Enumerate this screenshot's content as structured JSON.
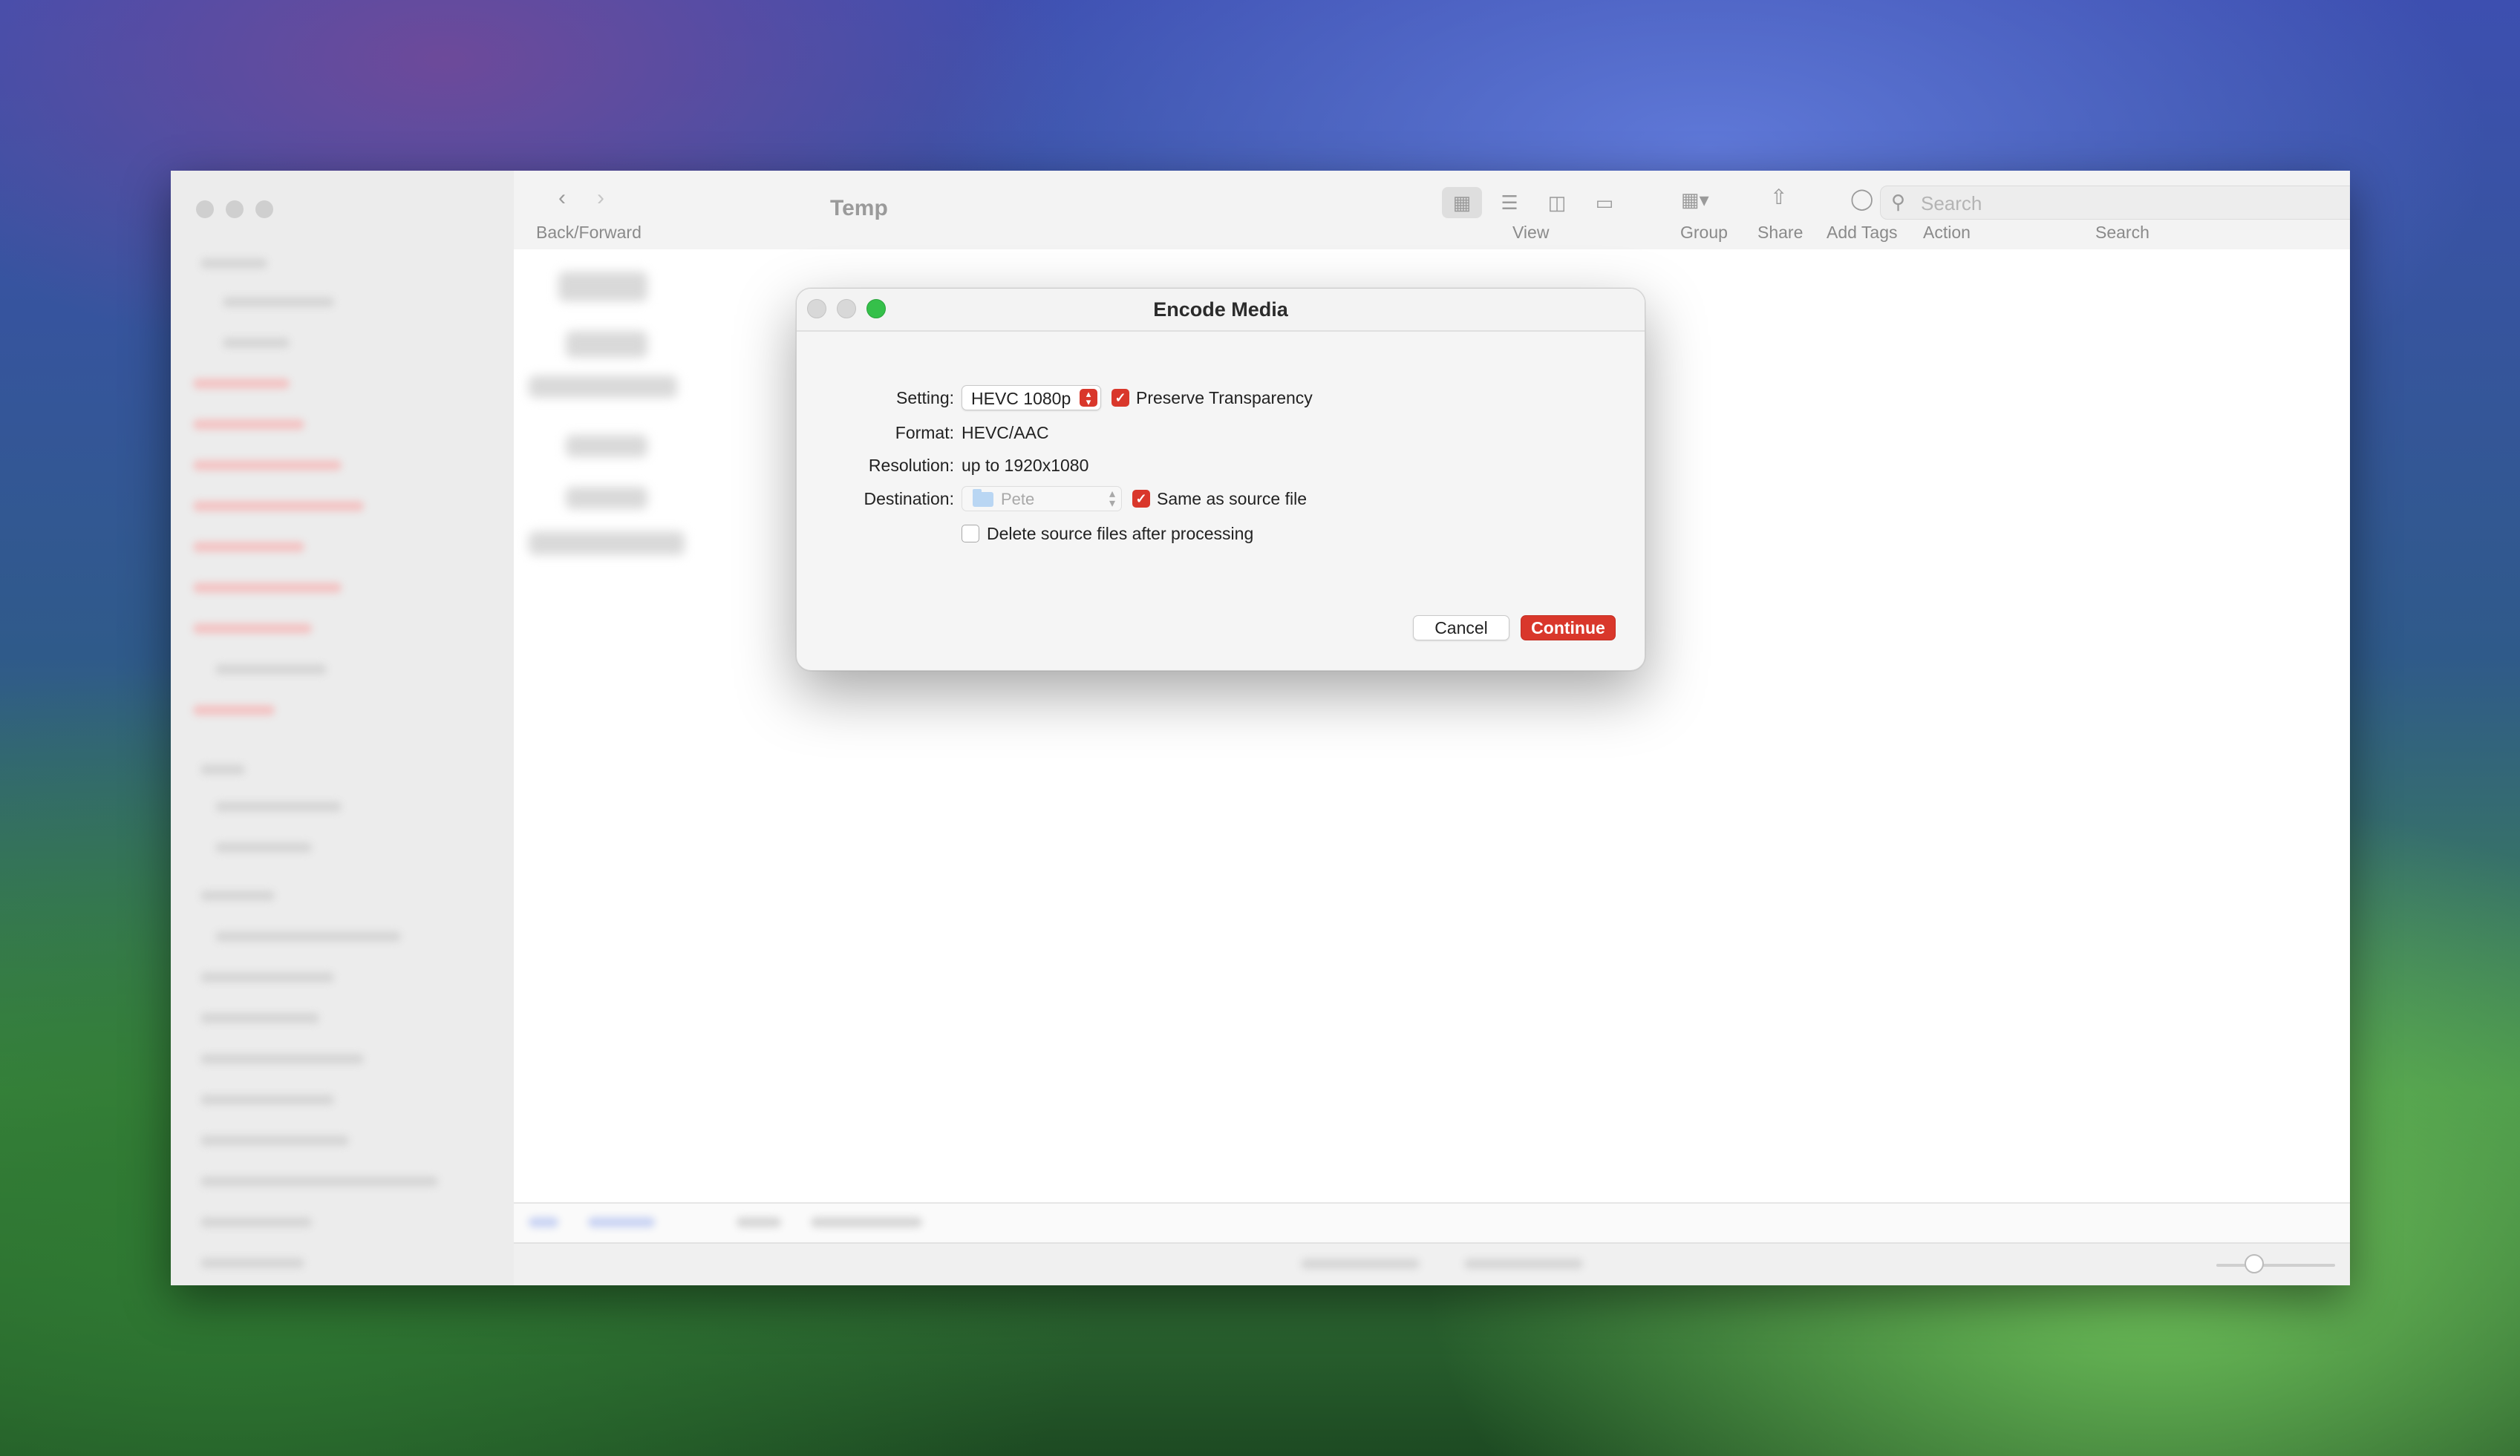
{
  "finder": {
    "title": "Temp",
    "toolbar": {
      "back_forward_label": "Back/Forward",
      "view_label": "View",
      "group_label": "Group",
      "share_label": "Share",
      "add_tags_label": "Add Tags",
      "action_label": "Action",
      "search_label": "Search",
      "search_placeholder": "Search"
    }
  },
  "dialog": {
    "title": "Encode Media",
    "setting_label": "Setting:",
    "setting_value": "HEVC 1080p",
    "preserve_transparency_label": "Preserve Transparency",
    "preserve_transparency_checked": true,
    "format_label": "Format:",
    "format_value": "HEVC/AAC",
    "resolution_label": "Resolution:",
    "resolution_value": "up to 1920x1080",
    "destination_label": "Destination:",
    "destination_value": "Pete",
    "same_as_source_label": "Same as source file",
    "same_as_source_checked": true,
    "delete_source_label": "Delete source files after processing",
    "delete_source_checked": false,
    "cancel_label": "Cancel",
    "continue_label": "Continue"
  },
  "colors": {
    "accent": "#d9372b",
    "zoom_green": "#35c04a"
  }
}
